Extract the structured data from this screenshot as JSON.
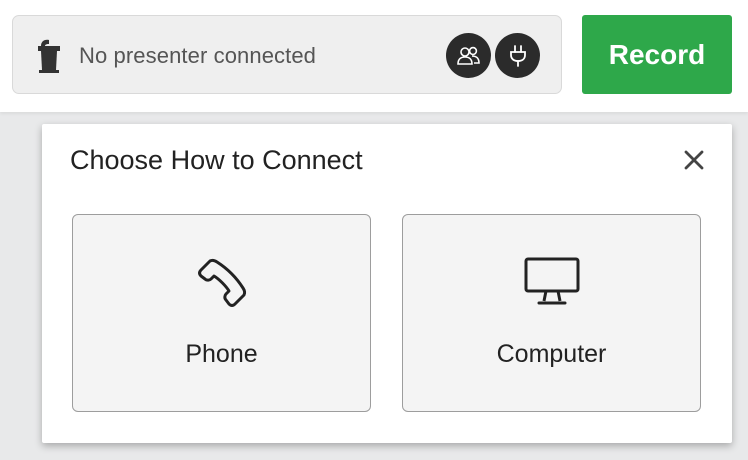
{
  "topbar": {
    "status_text": "No presenter connected",
    "podium_icon": "podium-icon",
    "people_icon": "people-icon",
    "plug_icon": "plug-icon",
    "record_label": "Record",
    "record_color": "#2ea84a"
  },
  "panel": {
    "title": "Choose How to Connect",
    "close_icon": "close-icon",
    "options": [
      {
        "label": "Phone",
        "icon": "phone-icon"
      },
      {
        "label": "Computer",
        "icon": "monitor-icon"
      }
    ]
  }
}
